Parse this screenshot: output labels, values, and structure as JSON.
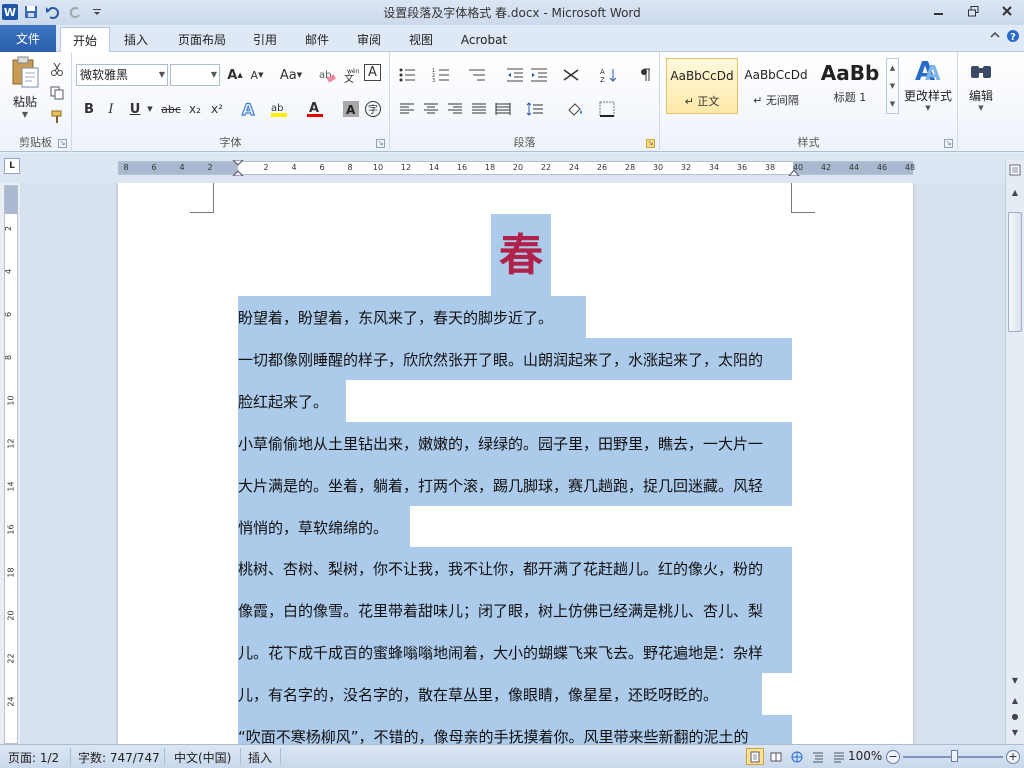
{
  "window": {
    "title": "设置段落及字体格式 春.docx  -  Microsoft Word",
    "app_icon": "W"
  },
  "tabs": {
    "file": "文件",
    "items": [
      "开始",
      "插入",
      "页面布局",
      "引用",
      "邮件",
      "审阅",
      "视图",
      "Acrobat"
    ],
    "active": "开始"
  },
  "ribbon": {
    "clipboard": {
      "paste": "粘贴",
      "label": "剪贴板"
    },
    "font": {
      "font_name": "微软雅黑",
      "font_size": "",
      "label": "字体",
      "bold": "B",
      "italic": "I",
      "underline": "U",
      "strike": "abc",
      "sub": "x₂",
      "sup": "x²",
      "grow": "A",
      "shrink": "A",
      "case": "Aa",
      "charborder": "A"
    },
    "paragraph": {
      "label": "段落"
    },
    "styles": {
      "label": "样式",
      "items": [
        {
          "preview": "AaBbCcDd",
          "name": "↵ 正文"
        },
        {
          "preview": "AaBbCcDd",
          "name": "↵ 无间隔"
        },
        {
          "preview": "AaBb",
          "name": "标题 1"
        }
      ],
      "change": "更改样式"
    },
    "editing": {
      "label": "编辑"
    }
  },
  "ruler": {
    "ticks": [
      "8",
      "6",
      "4",
      "2",
      "",
      "2",
      "4",
      "6",
      "8",
      "10",
      "12",
      "14",
      "16",
      "18",
      "20",
      "22",
      "24",
      "26",
      "28",
      "30",
      "32",
      "34",
      "36",
      "38",
      "40",
      "42",
      "44",
      "46",
      "48"
    ],
    "vticks": [
      "2",
      "4",
      "6",
      "8",
      "10",
      "12",
      "14",
      "16",
      "18",
      "20",
      "22",
      "24"
    ]
  },
  "document": {
    "title": "春",
    "lines": [
      "盼望着，盼望着，东风来了，春天的脚步近了。",
      "一切都像刚睡醒的样子，欣欣然张开了眼。山朗润起来了，水涨起来了，太阳的",
      "脸红起来了。",
      "小草偷偷地从土里钻出来，嫩嫩的，绿绿的。园子里，田野里，瞧去，一大片一",
      "大片满是的。坐着，躺着，打两个滚，踢几脚球，赛几趟跑，捉几回迷藏。风轻",
      "悄悄的，草软绵绵的。",
      "桃树、杏树、梨树，你不让我，我不让你，都开满了花赶趟儿。红的像火，粉的",
      "像霞，白的像雪。花里带着甜味儿；闭了眼，树上仿佛已经满是桃儿、杏儿、梨",
      "儿。花下成千成百的蜜蜂嗡嗡地闹着，大小的蝴蝶飞来飞去。野花遍地是：杂样",
      "儿，有名字的，没名字的，散在草丛里，像眼睛，像星星，还眨呀眨的。",
      "“吹面不寒杨柳风”，不错的，像母亲的手抚摸着你。风里带来些新翻的泥土的"
    ]
  },
  "status": {
    "page": "页面: 1/2",
    "words": "字数: 747/747",
    "lang": "中文(中国)",
    "mode": "插入",
    "zoom": "100%",
    "zoom_percent": 100
  }
}
